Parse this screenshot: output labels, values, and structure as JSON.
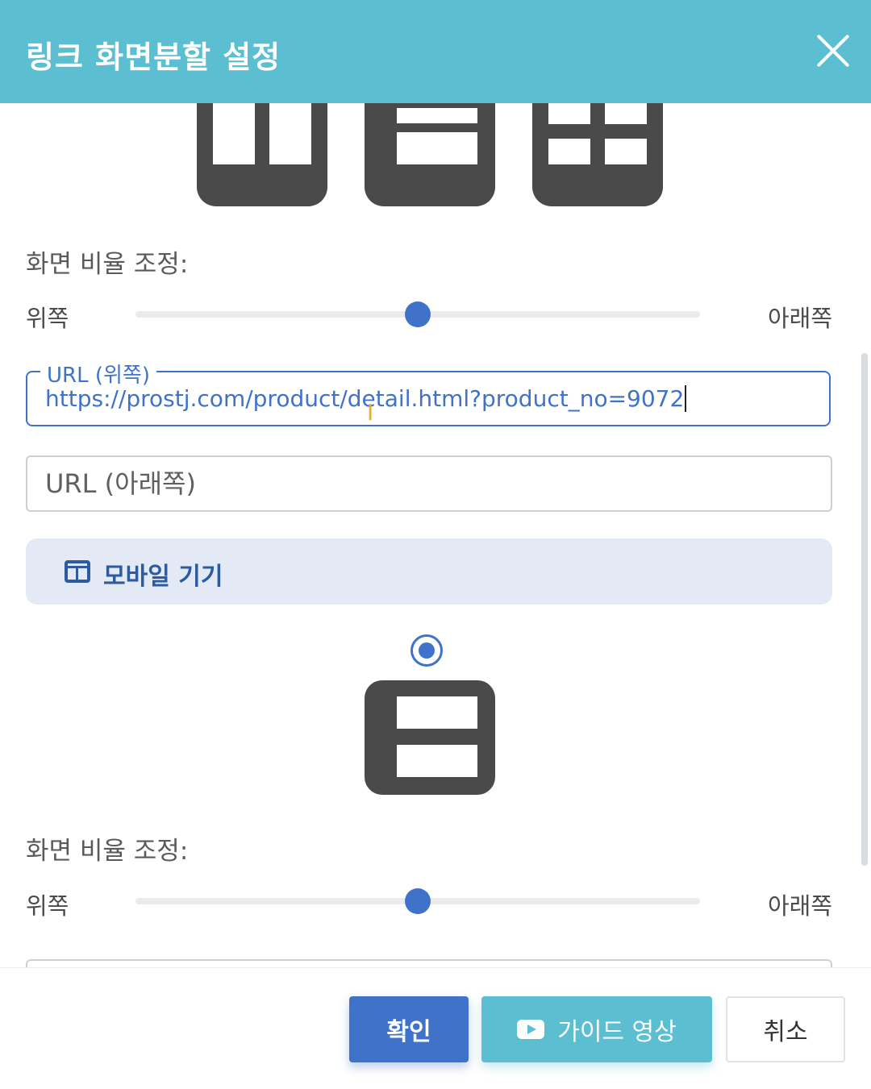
{
  "header": {
    "title": "링크 화면분할 설정",
    "bg_color": "#5bbfd1"
  },
  "desktop": {
    "layouts": [
      "split-vertical-icon",
      "split-horizontal-icon",
      "split-grid-icon"
    ],
    "ratio_label": "화면 비율 조정:",
    "slider": {
      "left_label": "위쪽",
      "right_label": "아래쪽",
      "value_percent": 50
    },
    "url_top": {
      "legend": "URL (위쪽)",
      "value": "https://prostj.com/product/detail.html?product_no=9072"
    },
    "url_bottom": {
      "placeholder": "URL (아래쪽)"
    }
  },
  "mobile": {
    "section_label": "모바일 기기",
    "section_icon": "columns-icon",
    "radio_selected": true,
    "layout": "split-horizontal-icon",
    "ratio_label": "화면 비율 조정:",
    "slider": {
      "left_label": "위쪽",
      "right_label": "아래쪽",
      "value_percent": 50
    }
  },
  "footer": {
    "confirm_label": "확인",
    "guide_label": "가이드 영상",
    "cancel_label": "취소"
  },
  "colors": {
    "accent": "#3f73c9",
    "teal": "#5bbfd1",
    "icon_dark": "#4a4a4a"
  }
}
